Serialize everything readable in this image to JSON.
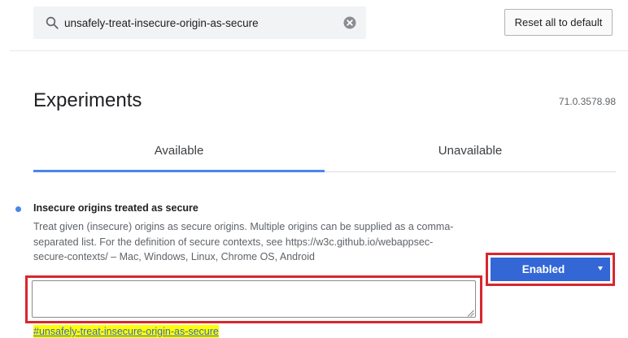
{
  "search": {
    "value": "unsafely-treat-insecure-origin-as-secure",
    "placeholder": "Search flags"
  },
  "header": {
    "reset_label": "Reset all to default"
  },
  "main": {
    "title": "Experiments",
    "version": "71.0.3578.98",
    "tabs": [
      {
        "label": "Available",
        "selected": true
      },
      {
        "label": "Unavailable",
        "selected": false
      }
    ]
  },
  "experiment": {
    "name": "Insecure origins treated as secure",
    "description": "Treat given (insecure) origins as secure origins. Multiple origins can be supplied as a comma-separated list. For the definition of secure contexts, see https://w3c.github.io/webappsec-secure-contexts/ – Mac, Windows, Linux, Chrome OS, Android",
    "textarea_value": "",
    "state": "Enabled",
    "permalink": "#unsafely-treat-insecure-origin-as-secure"
  },
  "icons": {
    "search": "search-icon",
    "clear": "close-circle-icon",
    "dropdown": "chevron-down-icon"
  },
  "colors": {
    "accent": "#4a86e8",
    "select_background": "#3367d6",
    "highlight_box": "#d9262e",
    "permalink_highlight": "#ffff00"
  }
}
